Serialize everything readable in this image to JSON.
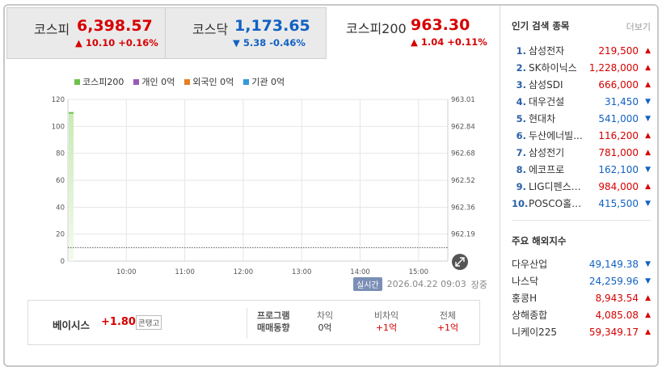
{
  "indices": [
    {
      "name": "코스피",
      "value": "6,398.57",
      "change": "▲ 10.10 +0.16%",
      "dir": "up"
    },
    {
      "name": "코스닥",
      "value": "1,173.65",
      "change": "▼ 5.38 -0.46%",
      "dir": "down"
    },
    {
      "name": "코스피200",
      "value": "963.30",
      "change": "▲ 1.04 +0.11%",
      "dir": "up"
    }
  ],
  "legend": [
    {
      "label": "코스피200",
      "color": "#6cc24a"
    },
    {
      "label": "개인 0억",
      "color": "#9b59b6"
    },
    {
      "label": "외국인 0억",
      "color": "#e67e22"
    },
    {
      "label": "기관 0억",
      "color": "#3498db"
    }
  ],
  "chart_data": {
    "type": "bar",
    "x_ticks": [
      "10:00",
      "11:00",
      "12:00",
      "13:00",
      "14:00",
      "15:00"
    ],
    "y_left_ticks": [
      "120",
      "100",
      "80",
      "60",
      "40",
      "20",
      "0"
    ],
    "y_right_ticks": [
      "963.01",
      "962.84",
      "962.68",
      "962.52",
      "962.36",
      "962.19"
    ],
    "ylim_left": [
      0,
      120
    ],
    "series": [
      {
        "name": "코스피200",
        "x": [
          "09:03"
        ],
        "values": [
          110
        ]
      }
    ],
    "reference_line": 10
  },
  "timestamp": {
    "live_label": "실시간",
    "time": "2026.04.22 09:03",
    "status": "장중"
  },
  "basis": {
    "label": "베이시스",
    "value": "+1.80",
    "tag": "콘탱고"
  },
  "program": {
    "title_line1": "프로그램",
    "title_line2": "매매동향",
    "cols": [
      {
        "header": "차익",
        "value": "0억",
        "dir": "flat"
      },
      {
        "header": "비차익",
        "value": "+1억",
        "dir": "up"
      },
      {
        "header": "전체",
        "value": "+1억",
        "dir": "up"
      }
    ]
  },
  "popular": {
    "title": "인기 검색 종목",
    "more": "더보기",
    "items": [
      {
        "rank": "1.",
        "name": "삼성전자",
        "price": "219,500",
        "dir": "up"
      },
      {
        "rank": "2.",
        "name": "SK하이닉스",
        "price": "1,228,000",
        "dir": "up"
      },
      {
        "rank": "3.",
        "name": "삼성SDI",
        "price": "666,000",
        "dir": "up"
      },
      {
        "rank": "4.",
        "name": "대우건설",
        "price": "31,450",
        "dir": "down"
      },
      {
        "rank": "5.",
        "name": "현대차",
        "price": "541,000",
        "dir": "down"
      },
      {
        "rank": "6.",
        "name": "두산에너빌...",
        "price": "116,200",
        "dir": "up"
      },
      {
        "rank": "7.",
        "name": "삼성전기",
        "price": "781,000",
        "dir": "up"
      },
      {
        "rank": "8.",
        "name": "에코프로",
        "price": "162,100",
        "dir": "down"
      },
      {
        "rank": "9.",
        "name": "LIG디펜스…",
        "price": "984,000",
        "dir": "up"
      },
      {
        "rank": "10.",
        "name": "POSCO홀…",
        "price": "415,500",
        "dir": "down"
      }
    ]
  },
  "overseas": {
    "title": "주요 해외지수",
    "items": [
      {
        "name": "다우산업",
        "price": "49,149.38",
        "dir": "down"
      },
      {
        "name": "나스닥",
        "price": "24,259.96",
        "dir": "down"
      },
      {
        "name": "홍콩H",
        "price": "8,943.54",
        "dir": "up"
      },
      {
        "name": "상해종합",
        "price": "4,085.08",
        "dir": "up"
      },
      {
        "name": "니케이225",
        "price": "59,349.17",
        "dir": "up"
      }
    ]
  },
  "colors": {
    "up": "#d60000",
    "down": "#1261c4",
    "line": "#6cc24a"
  }
}
